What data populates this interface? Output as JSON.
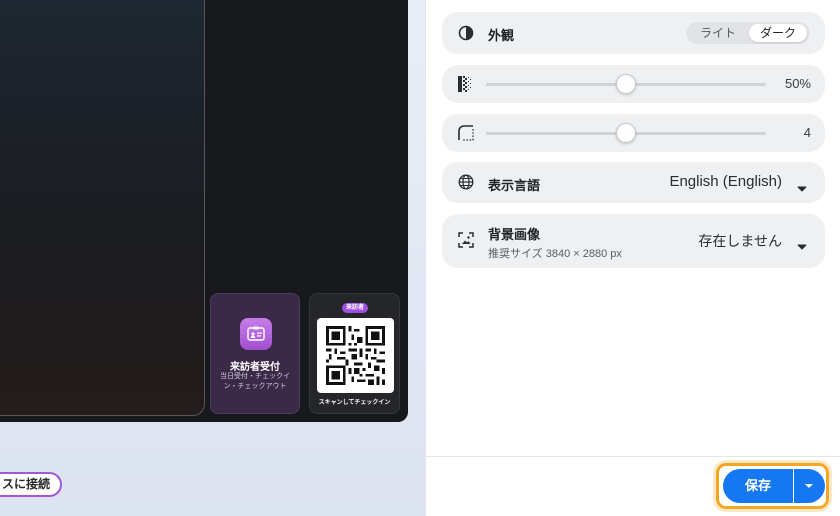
{
  "preview": {
    "visitor_tile": {
      "title": "来訪者受付",
      "subtitle": "当日受付・チェックイン・チェックアウト"
    },
    "qr_tile": {
      "badge": "来訪者",
      "caption": "スキャンしてチェックイン"
    },
    "connect_pill": "スに接続"
  },
  "settings": {
    "appearance": {
      "label": "外観",
      "options": [
        "ライト",
        "ダーク"
      ],
      "selected": "ダーク"
    },
    "opacity": {
      "value": 50,
      "display": "50%",
      "icon": "opacity-icon"
    },
    "corner_radius": {
      "value": 4,
      "display": "4",
      "icon": "corner-radius-icon"
    },
    "language": {
      "label": "表示言語",
      "value": "English (English)",
      "icon": "globe-icon"
    },
    "background_image": {
      "label": "背景画像",
      "sub": "推奨サイズ 3840 × 2880 px",
      "value": "存在しません",
      "icon": "image-icon"
    }
  },
  "footer": {
    "save_label": "保存"
  },
  "colors": {
    "accent": "#1577f2",
    "focus_ring": "#f5a623",
    "purple": "#a158d8"
  }
}
